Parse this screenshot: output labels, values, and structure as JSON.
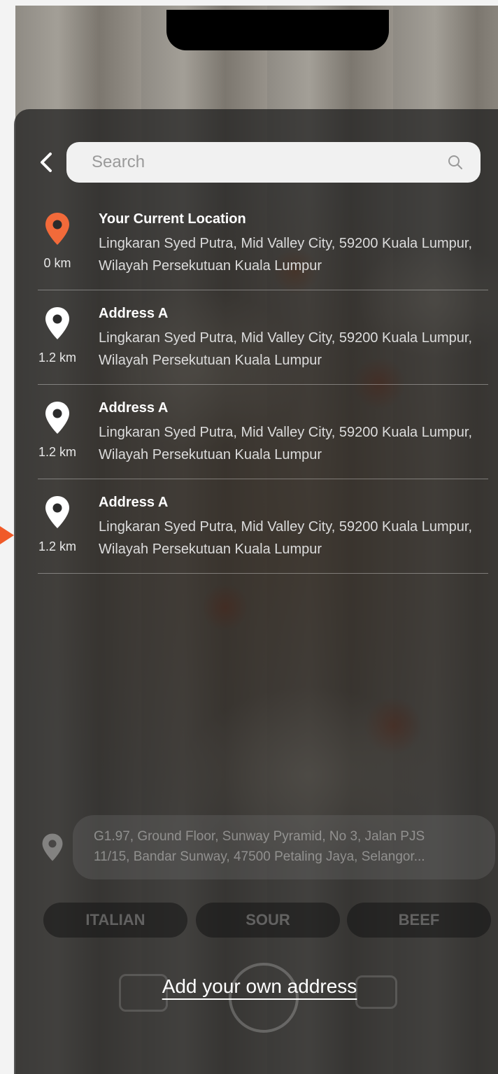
{
  "search": {
    "placeholder": "Search"
  },
  "locations": [
    {
      "title": "Your Current Location",
      "address": "Lingkaran Syed Putra, Mid Valley City, 59200 Kuala Lumpur, Wilayah Persekutuan Kuala Lumpur",
      "distance": "0 km",
      "pin_color": "#f26a3a"
    },
    {
      "title": "Address A",
      "address": "Lingkaran Syed Putra, Mid Valley City, 59200 Kuala Lumpur, Wilayah Persekutuan Kuala Lumpur",
      "distance": "1.2 km",
      "pin_color": "#ffffff"
    },
    {
      "title": "Address A",
      "address": "Lingkaran Syed Putra, Mid Valley City, 59200 Kuala Lumpur, Wilayah Persekutuan Kuala Lumpur",
      "distance": "1.2 km",
      "pin_color": "#ffffff"
    },
    {
      "title": "Address A",
      "address": "Lingkaran Syed Putra, Mid Valley City, 59200 Kuala Lumpur, Wilayah Persekutuan Kuala Lumpur",
      "distance": "1.2 km",
      "pin_color": "#ffffff"
    }
  ],
  "background": {
    "address_line1": "G1.97, Ground Floor, Sunway Pyramid, No 3, Jalan PJS",
    "address_line2": "11/15, Bandar Sunway, 47500 Petaling Jaya, Selangor...",
    "chips": [
      "ITALIAN",
      "SOUR",
      "BEEF"
    ]
  },
  "actions": {
    "add_address": "Add your own address"
  },
  "colors": {
    "accent": "#f26a3a",
    "teal": "#29a7b5"
  }
}
